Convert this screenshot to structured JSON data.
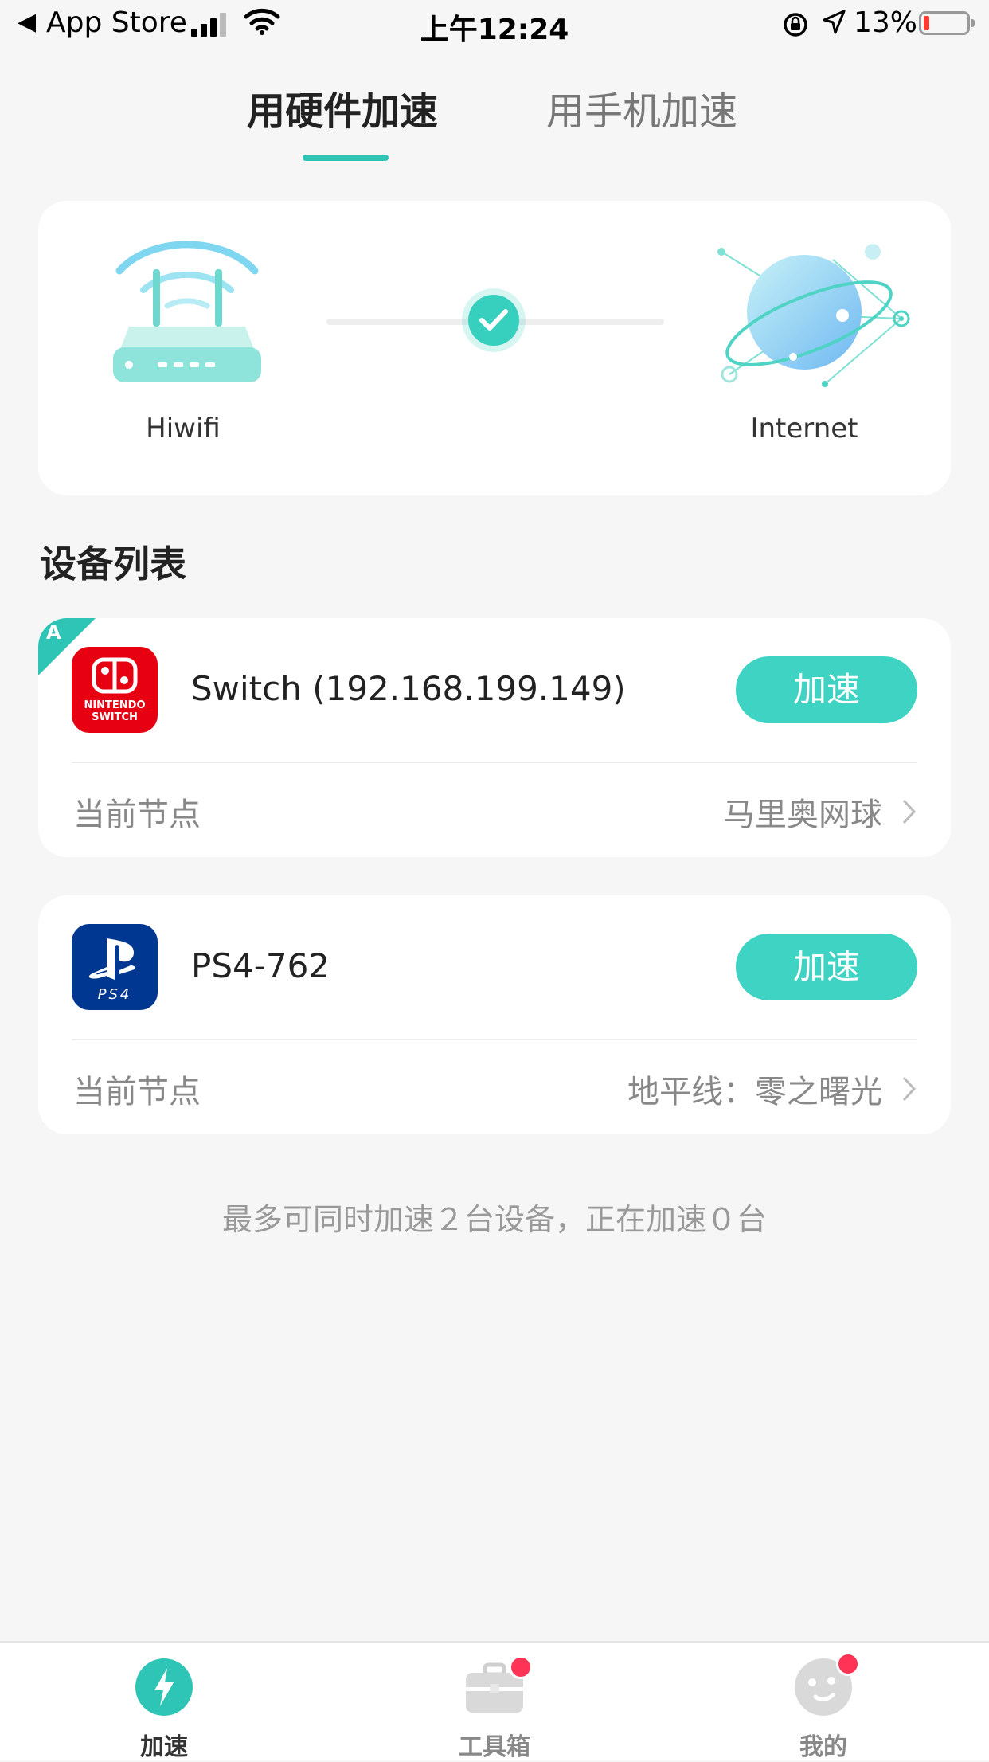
{
  "status_bar": {
    "back_arrow": "◀",
    "back_app": "App Store",
    "time": "上午12:24",
    "battery": "13%",
    "icons": [
      "signal-icon",
      "wifi-icon",
      "orientation-lock-icon",
      "location-icon",
      "battery-icon"
    ],
    "battery_level": 0.13,
    "battery_low_color": "#ff3b30"
  },
  "tabs": [
    {
      "label": "用硬件加速",
      "active": true
    },
    {
      "label": "用手机加速",
      "active": false
    }
  ],
  "connection": {
    "source_label": "Hiwifi",
    "target_label": "Internet",
    "status": "connected",
    "icons": [
      "router-icon",
      "check-icon",
      "planet-icon"
    ]
  },
  "devices_section": {
    "title": "设备列表"
  },
  "devices": [
    {
      "badge": "A",
      "name": "Switch (192.168.199.149)",
      "icon": "nintendo-switch-icon",
      "logo_text": "NINTENDO SWITCH",
      "button_label": "加速",
      "node_label": "当前节点",
      "node_value": "马里奥网球"
    },
    {
      "name": "PS4-762",
      "icon": "ps4-icon",
      "logo_text": "PS4",
      "button_label": "加速",
      "node_label": "当前节点",
      "node_value": "地平线：零之曙光"
    }
  ],
  "footnote": "最多可同时加速２台设备，正在加速０台",
  "bottom_nav": [
    {
      "label": "加速",
      "icon": "lightning-icon",
      "active": true,
      "color": "#2ec4b6"
    },
    {
      "label": "工具箱",
      "icon": "toolbox-icon",
      "badge": true
    },
    {
      "label": "我的",
      "icon": "profile-face-icon",
      "badge": true
    }
  ],
  "colors": {
    "accent": "#2ec4b6",
    "button": "#3fd3c3",
    "badge_red": "#ff3355",
    "switch_red": "#e60012",
    "ps_blue": "#003791"
  }
}
